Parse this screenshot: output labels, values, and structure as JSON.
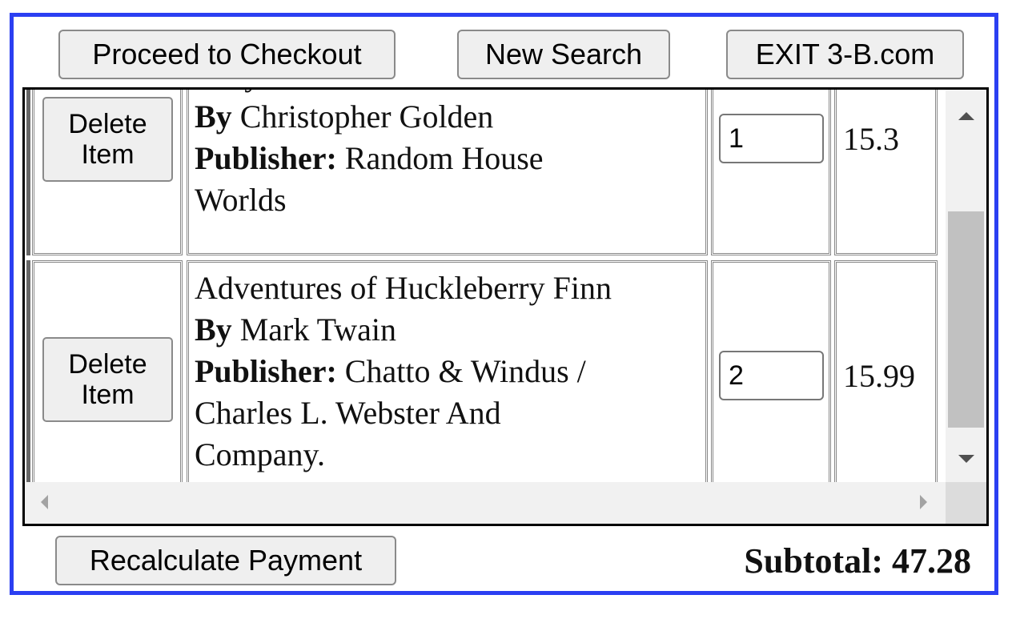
{
  "toolbar": {
    "checkout_label": "Proceed to Checkout",
    "new_search_label": "New Search",
    "exit_label": "EXIT 3-B.com"
  },
  "cart": {
    "items": [
      {
        "delete_label_line1": "Delete",
        "delete_label_line2": "Item",
        "title": "Labyrinth",
        "by_label": "By",
        "author": "Christopher Golden",
        "publisher_label": "Publisher:",
        "publisher_line1": "Random House",
        "publisher_line2": "Worlds",
        "quantity": "1",
        "price": "15.3"
      },
      {
        "delete_label_line1": "Delete",
        "delete_label_line2": "Item",
        "title": "Adventures of Huckleberry Finn",
        "by_label": "By",
        "author": "Mark Twain",
        "publisher_label": "Publisher:",
        "publisher_line1": "Chatto & Windus /",
        "publisher_line2": "Charles L. Webster And",
        "publisher_line3": "Company."
      }
    ]
  },
  "cart_item2_quantity": "2",
  "cart_item2_price": "15.99",
  "footer": {
    "recalculate_label": "Recalculate Payment",
    "subtotal_text": "Subtotal: 47.28"
  }
}
